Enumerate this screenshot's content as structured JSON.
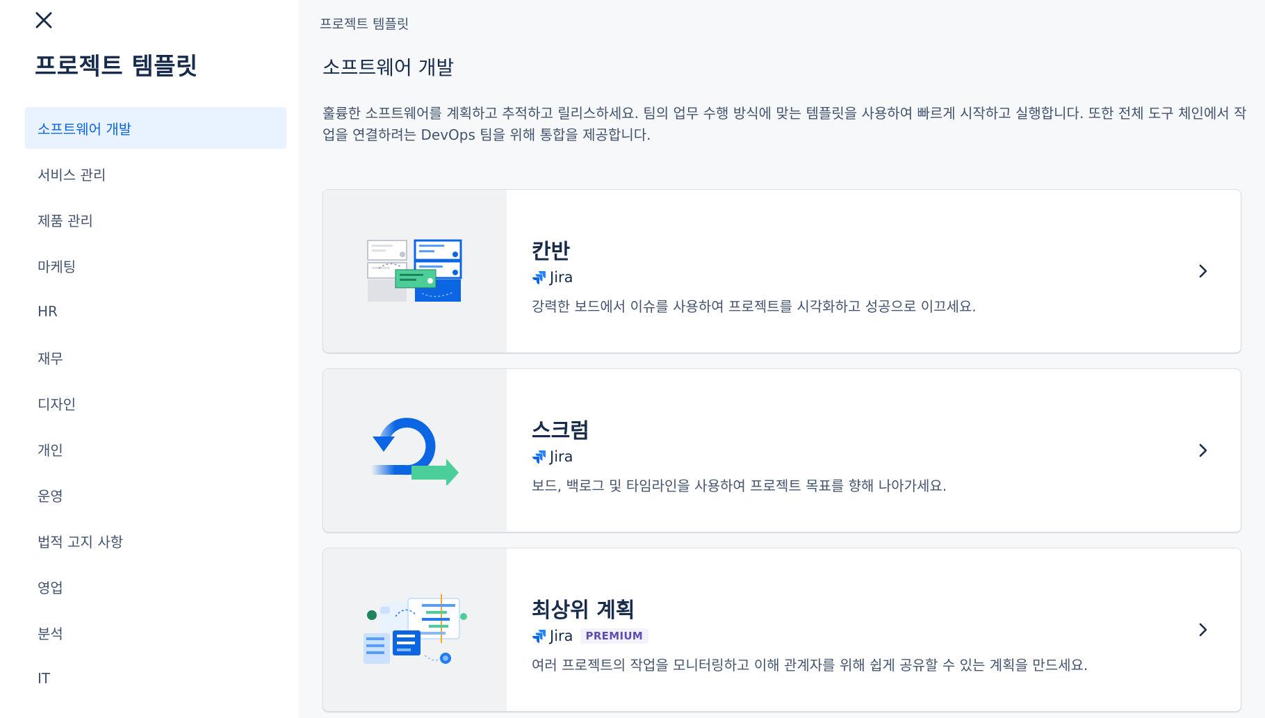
{
  "sidebar": {
    "title": "프로젝트 템플릿",
    "items": [
      {
        "label": "소프트웨어 개발",
        "active": true
      },
      {
        "label": "서비스 관리"
      },
      {
        "label": "제품 관리"
      },
      {
        "label": "마케팅"
      },
      {
        "label": "HR"
      },
      {
        "label": "재무"
      },
      {
        "label": "디자인"
      },
      {
        "label": "개인"
      },
      {
        "label": "운영"
      },
      {
        "label": "법적 고지 사항"
      },
      {
        "label": "영업"
      },
      {
        "label": "분석"
      },
      {
        "label": "IT"
      }
    ]
  },
  "main": {
    "breadcrumb": "프로젝트 템플릿",
    "title": "소프트웨어 개발",
    "description": "훌륭한 소프트웨어를 계획하고 추적하고 릴리스하세요. 팀의 업무 수행 방식에 맞는 템플릿을 사용하여 빠르게 시작하고 실행합니다. 또한 전체 도구 체인에서 작업을 연결하려는 DevOps 팀을 위해 통합을 제공합니다.",
    "cards": [
      {
        "title": "칸반",
        "product": "Jira",
        "description": "강력한 보드에서 이슈를 사용하여 프로젝트를 시각화하고 성공으로 이끄세요.",
        "icon": "kanban-illustration"
      },
      {
        "title": "스크럼",
        "product": "Jira",
        "description": "보드, 백로그 및 타임라인을 사용하여 프로젝트 목표를 향해 나아가세요.",
        "icon": "scrum-illustration"
      },
      {
        "title": "최상위 계획",
        "product": "Jira",
        "badge": "PREMIUM",
        "description": "여러 프로젝트의 작업을 모니터링하고 이해 관계자를 위해 쉽게 공유할 수 있는 계획을 만드세요.",
        "icon": "top-level-planning-illustration"
      }
    ]
  },
  "colors": {
    "accent": "#0c66e4",
    "active_bg": "#e9f2ff",
    "main_bg": "#f7f8f9"
  }
}
